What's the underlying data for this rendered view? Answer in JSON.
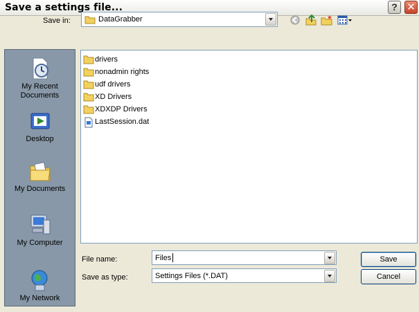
{
  "window": {
    "title": "Save a settings file...",
    "help_glyph": "?",
    "close_glyph": "✕"
  },
  "save_in": {
    "label": "Save in:",
    "value": "DataGrabber"
  },
  "toolbar": {
    "icons": [
      "back-icon",
      "up-folder-icon",
      "new-folder-icon",
      "views-menu-icon"
    ]
  },
  "places": [
    {
      "label": "My Recent Documents",
      "line1": "My Recent",
      "line2": "Documents",
      "icon": "recent-documents-icon"
    },
    {
      "label": "Desktop",
      "line1": "Desktop",
      "line2": "",
      "icon": "desktop-icon"
    },
    {
      "label": "My Documents",
      "line1": "My Documents",
      "line2": "",
      "icon": "my-documents-icon"
    },
    {
      "label": "My Computer",
      "line1": "My Computer",
      "line2": "",
      "icon": "my-computer-icon"
    },
    {
      "label": "My Network",
      "line1": "My Network",
      "line2": "",
      "icon": "my-network-icon"
    }
  ],
  "files": [
    {
      "name": "drivers",
      "type": "folder"
    },
    {
      "name": "nonadmin rights",
      "type": "folder"
    },
    {
      "name": "udf drivers",
      "type": "folder"
    },
    {
      "name": "XD Drivers",
      "type": "folder"
    },
    {
      "name": "XDXDP Drivers",
      "type": "folder"
    },
    {
      "name": "LastSession.dat",
      "type": "file"
    }
  ],
  "file_name": {
    "label": "File name:",
    "value": "Files"
  },
  "save_as_type": {
    "label": "Save as type:",
    "value": "Settings Files (*.DAT)"
  },
  "buttons": {
    "save": "Save",
    "cancel": "Cancel"
  },
  "colors": {
    "dialog_bg": "#ece9d8",
    "places_bg": "#8898a8",
    "folder_yellow": "#f2d160",
    "close_red": "#c8442a"
  }
}
